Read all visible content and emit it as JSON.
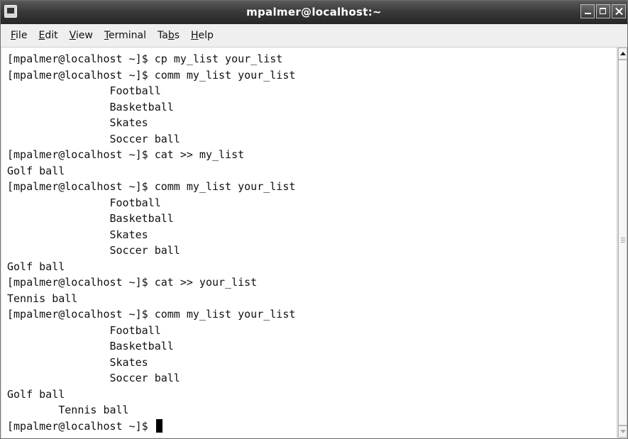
{
  "window": {
    "title": "mpalmer@localhost:~"
  },
  "menu": [
    {
      "pre": "",
      "mnemonic": "F",
      "post": "ile"
    },
    {
      "pre": "",
      "mnemonic": "E",
      "post": "dit"
    },
    {
      "pre": "",
      "mnemonic": "V",
      "post": "iew"
    },
    {
      "pre": "",
      "mnemonic": "T",
      "post": "erminal"
    },
    {
      "pre": "Ta",
      "mnemonic": "b",
      "post": "s"
    },
    {
      "pre": "",
      "mnemonic": "H",
      "post": "elp"
    }
  ],
  "terminal": {
    "lines": [
      "[mpalmer@localhost ~]$ cp my_list your_list",
      "[mpalmer@localhost ~]$ comm my_list your_list",
      "                Football",
      "                Basketball",
      "                Skates",
      "                Soccer ball",
      "[mpalmer@localhost ~]$ cat >> my_list",
      "Golf ball",
      "[mpalmer@localhost ~]$ comm my_list your_list",
      "                Football",
      "                Basketball",
      "                Skates",
      "                Soccer ball",
      "Golf ball",
      "[mpalmer@localhost ~]$ cat >> your_list",
      "Tennis ball",
      "[mpalmer@localhost ~]$ comm my_list your_list",
      "                Football",
      "                Basketball",
      "                Skates",
      "                Soccer ball",
      "Golf ball",
      "        Tennis ball"
    ],
    "prompt": "[mpalmer@localhost ~]$ "
  },
  "icons": {
    "window_icon": "terminal-icon",
    "minimize": "minimize-icon",
    "maximize": "maximize-icon",
    "close": "close-icon"
  }
}
